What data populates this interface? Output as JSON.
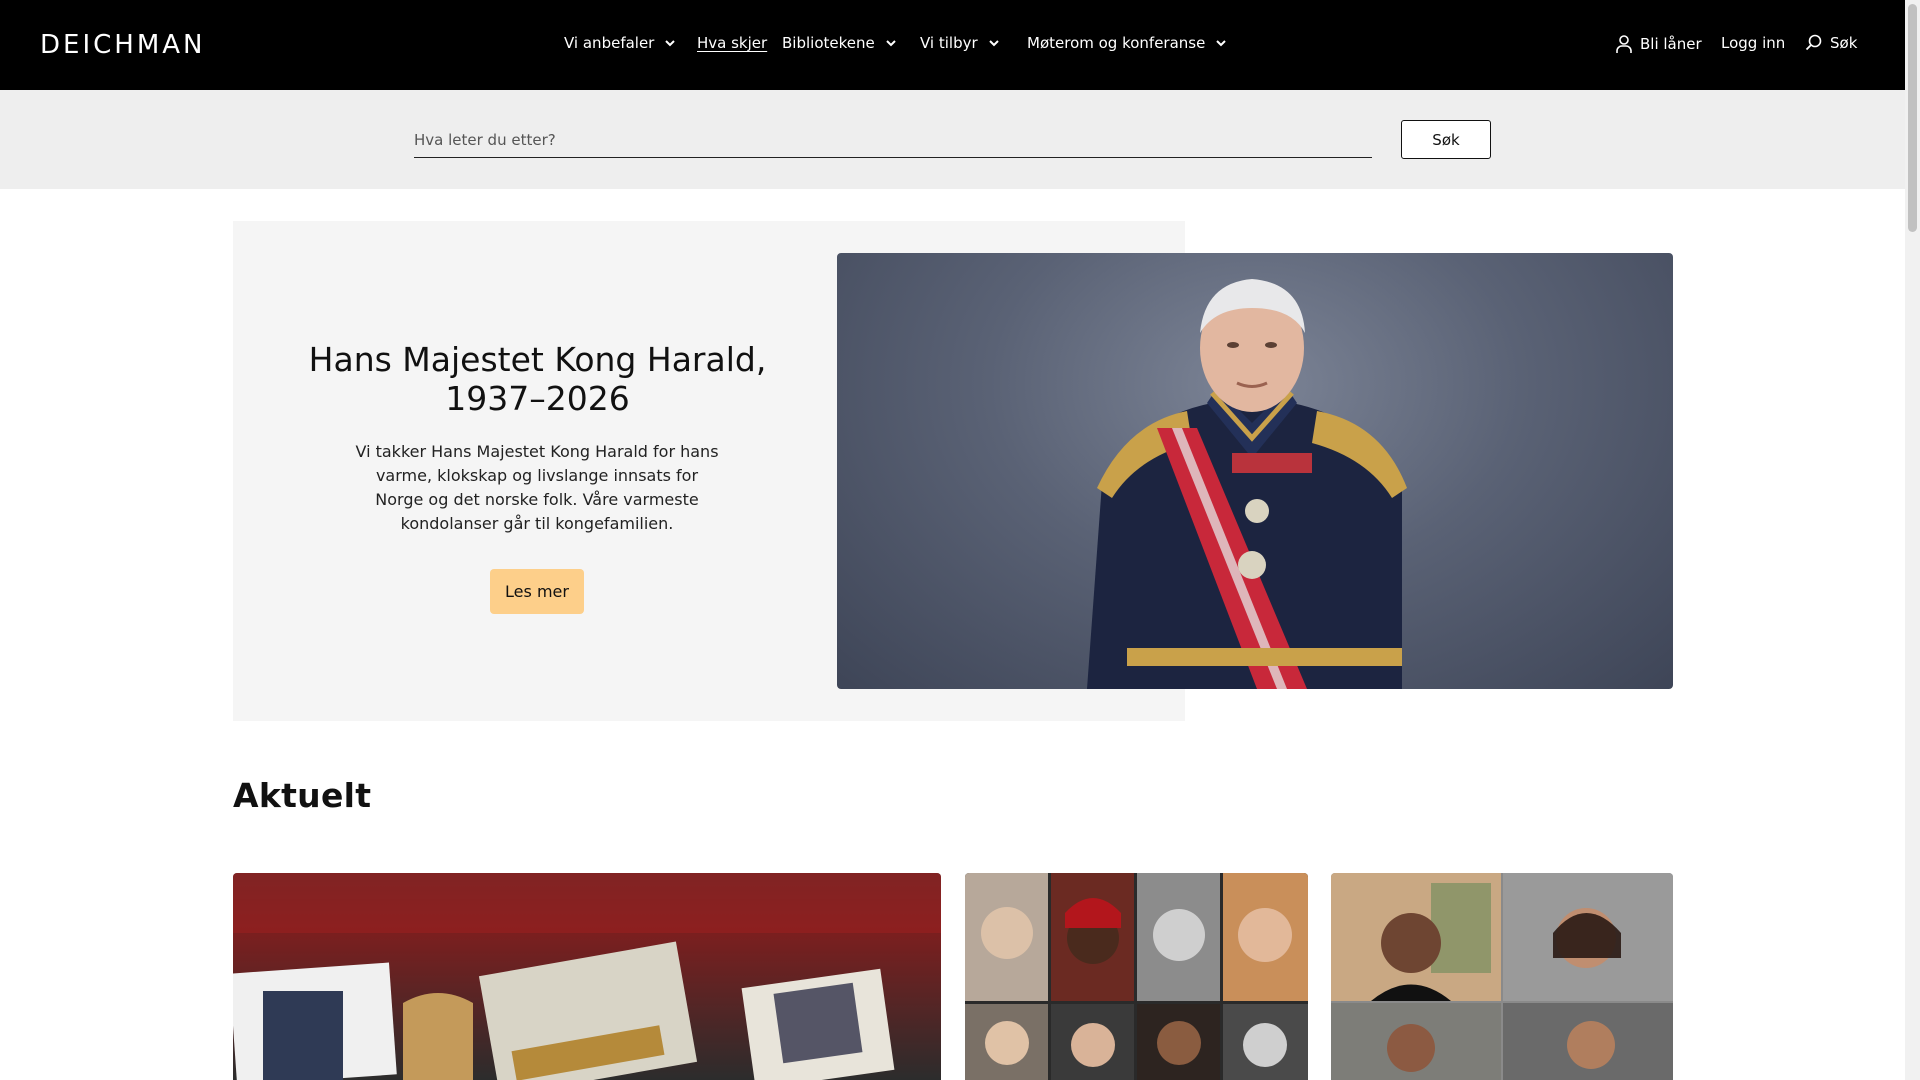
{
  "header": {
    "logo": "DEICHMAN",
    "nav": [
      {
        "label": "Vi anbefaler",
        "has_dropdown": true
      },
      {
        "label": "Hva skjer",
        "has_dropdown": false,
        "active": true
      },
      {
        "label": "Bibliotekene",
        "has_dropdown": true
      },
      {
        "label": "Vi tilbyr",
        "has_dropdown": true
      },
      {
        "label": "Møterom og konferanse",
        "has_dropdown": true
      }
    ],
    "become_borrower": "Bli låner",
    "login": "Logg inn",
    "search": "Søk"
  },
  "search": {
    "placeholder": "Hva leter du etter?",
    "button": "Søk"
  },
  "hero": {
    "title": "Hans Majestet Kong Harald, 1937–2026",
    "body": "Vi takker Hans Majestet Kong Harald for hans varme, klokskap og livslange innsats for Norge og det norske folk. Våre varmeste kondolanser går til kongefamilien.",
    "cta": "Les mer",
    "cta_color": "#fdcf8a",
    "image_alt": "portrait"
  },
  "aktuelt": {
    "title": "Aktuelt"
  },
  "colors": {
    "header_bg": "#000000",
    "search_band_bg": "#eeeeee",
    "hero_panel_bg": "#f5f5f5"
  }
}
